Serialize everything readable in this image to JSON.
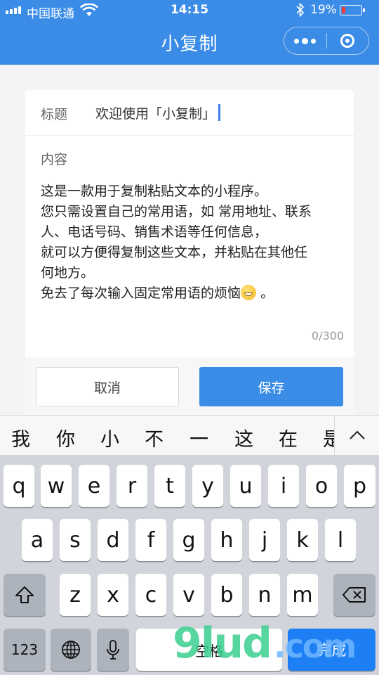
{
  "status_bar": {
    "carrier": "中国联通",
    "time": "14:15",
    "battery_percent": "19%",
    "battery_level": 0.19,
    "battery_color": "#ff3b30"
  },
  "nav": {
    "title": "小复制",
    "background": "#3b8ce6",
    "more_icon": "more-dots-icon",
    "close_icon": "close-target-icon"
  },
  "form": {
    "title_label": "标题",
    "title_value": "欢迎使用「小复制」",
    "content_label": "内容",
    "content_lines": [
      "这是一款用于复制粘贴文本的小程序。",
      "您只需设置自己的常用语，如 常用地址、联系",
      "人、电话号码、销售术语等任何信息，",
      "就可以方便得复制这些文本，并粘贴在其他任",
      "何地方。",
      "免去了每次输入固定常用语的烦恼"
    ],
    "content_tail": "。",
    "emoji_icon": "grinning-emoji-icon",
    "counter": "0/300",
    "cancel_label": "取消",
    "save_label": "保存"
  },
  "keyboard": {
    "candidates": [
      "我",
      "你",
      "小",
      "不",
      "一",
      "这",
      "在",
      "是"
    ],
    "row1": [
      "q",
      "w",
      "e",
      "r",
      "t",
      "y",
      "u",
      "i",
      "o",
      "p"
    ],
    "row2": [
      "a",
      "s",
      "d",
      "f",
      "g",
      "h",
      "j",
      "k",
      "l"
    ],
    "row3": [
      "z",
      "x",
      "c",
      "v",
      "b",
      "n",
      "m"
    ],
    "numbers_label": "123",
    "space_label": "空格",
    "done_label": "完成",
    "accent": "#1d7ff3"
  },
  "watermark": {
    "text": "9lud",
    "suffix": ".com"
  }
}
